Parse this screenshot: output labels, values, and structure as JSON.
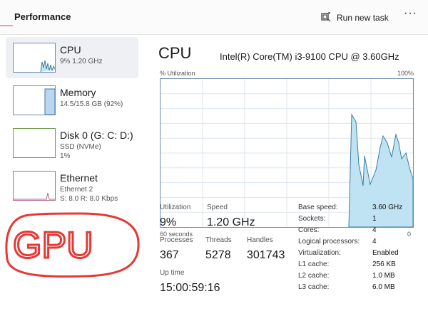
{
  "header": {
    "title": "Performance",
    "run_new_task": "Run new task",
    "more": "···"
  },
  "sidebar": {
    "items": [
      {
        "name": "CPU",
        "sub1": "9% 1.20 GHz",
        "sub2": "",
        "selected": true
      },
      {
        "name": "Memory",
        "sub1": "14.5/15.8 GB (92%)",
        "sub2": "",
        "selected": false
      },
      {
        "name": "Disk 0 (G: C: D:)",
        "sub1": "SSD (NVMe)",
        "sub2": "1%",
        "selected": false
      },
      {
        "name": "Ethernet",
        "sub1": "Ethernet 2",
        "sub2": "S: 8.0 R: 8.0 Kbps",
        "selected": false
      }
    ]
  },
  "main": {
    "title": "CPU",
    "model": "Intel(R) Core(TM) i3-9100 CPU @ 3.60GHz",
    "util_label": "% Utilization",
    "util_max": "100%",
    "graph_left": "60 seconds",
    "graph_right": "0",
    "stats": {
      "utilization_label": "Utilization",
      "utilization": "9%",
      "speed_label": "Speed",
      "speed": "1.20 GHz",
      "processes_label": "Processes",
      "processes": "367",
      "threads_label": "Threads",
      "threads": "5278",
      "handles_label": "Handles",
      "handles": "301743",
      "uptime_label": "Up time",
      "uptime": "15:00:59:16"
    },
    "specs": [
      {
        "label": "Base speed:",
        "value": "3.60 GHz"
      },
      {
        "label": "Sockets:",
        "value": "1"
      },
      {
        "label": "Cores:",
        "value": "4"
      },
      {
        "label": "Logical processors:",
        "value": "4"
      },
      {
        "label": "Virtualization:",
        "value": "Enabled"
      },
      {
        "label": "L1 cache:",
        "value": "256 KB"
      },
      {
        "label": "L2 cache:",
        "value": "1.0 MB"
      },
      {
        "label": "L3 cache:",
        "value": "6.0 MB"
      }
    ]
  },
  "annotation": {
    "text": "GPU",
    "color": "#e53935"
  },
  "colors": {
    "accent": "#6a8cb3",
    "graph_fill": "#bfe3f3"
  }
}
